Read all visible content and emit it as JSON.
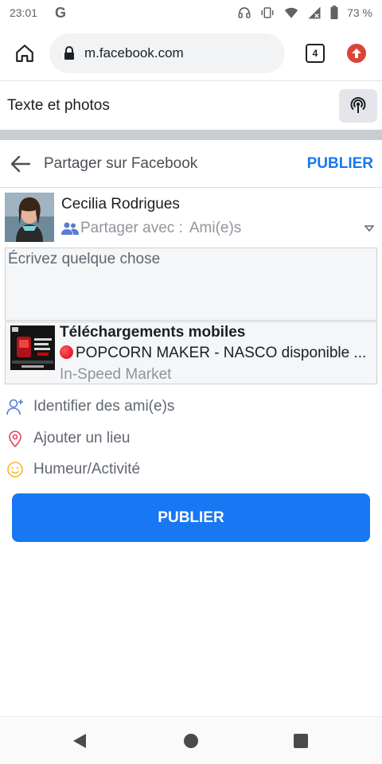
{
  "status_bar": {
    "time": "23:01",
    "g_label": "G",
    "battery": "73 %"
  },
  "browser": {
    "url": "m.facebook.com",
    "tab_count": "4"
  },
  "page": {
    "title": "Texte et photos"
  },
  "share_header": {
    "title": "Partager sur Facebook",
    "publish_label": "PUBLIER"
  },
  "user": {
    "name": "Cecilia Rodrigues",
    "share_with_label": "Partager avec :",
    "share_with_value": "Ami(e)s"
  },
  "composer": {
    "placeholder": "Écrivez quelque chose"
  },
  "link_preview": {
    "title": "Téléchargements mobiles",
    "description": "POPCORN MAKER - NASCO disponible ...",
    "source": "In-Speed Market"
  },
  "actions": {
    "tag_friends": "Identifier des ami(e)s",
    "add_location": "Ajouter un lieu",
    "mood": "Humeur/Activité"
  },
  "publish_button": "PUBLIER",
  "colors": {
    "brand": "#1877f2",
    "location_icon": "#e4405f",
    "mood_icon": "#f7b928",
    "update_badge": "#db4437"
  }
}
